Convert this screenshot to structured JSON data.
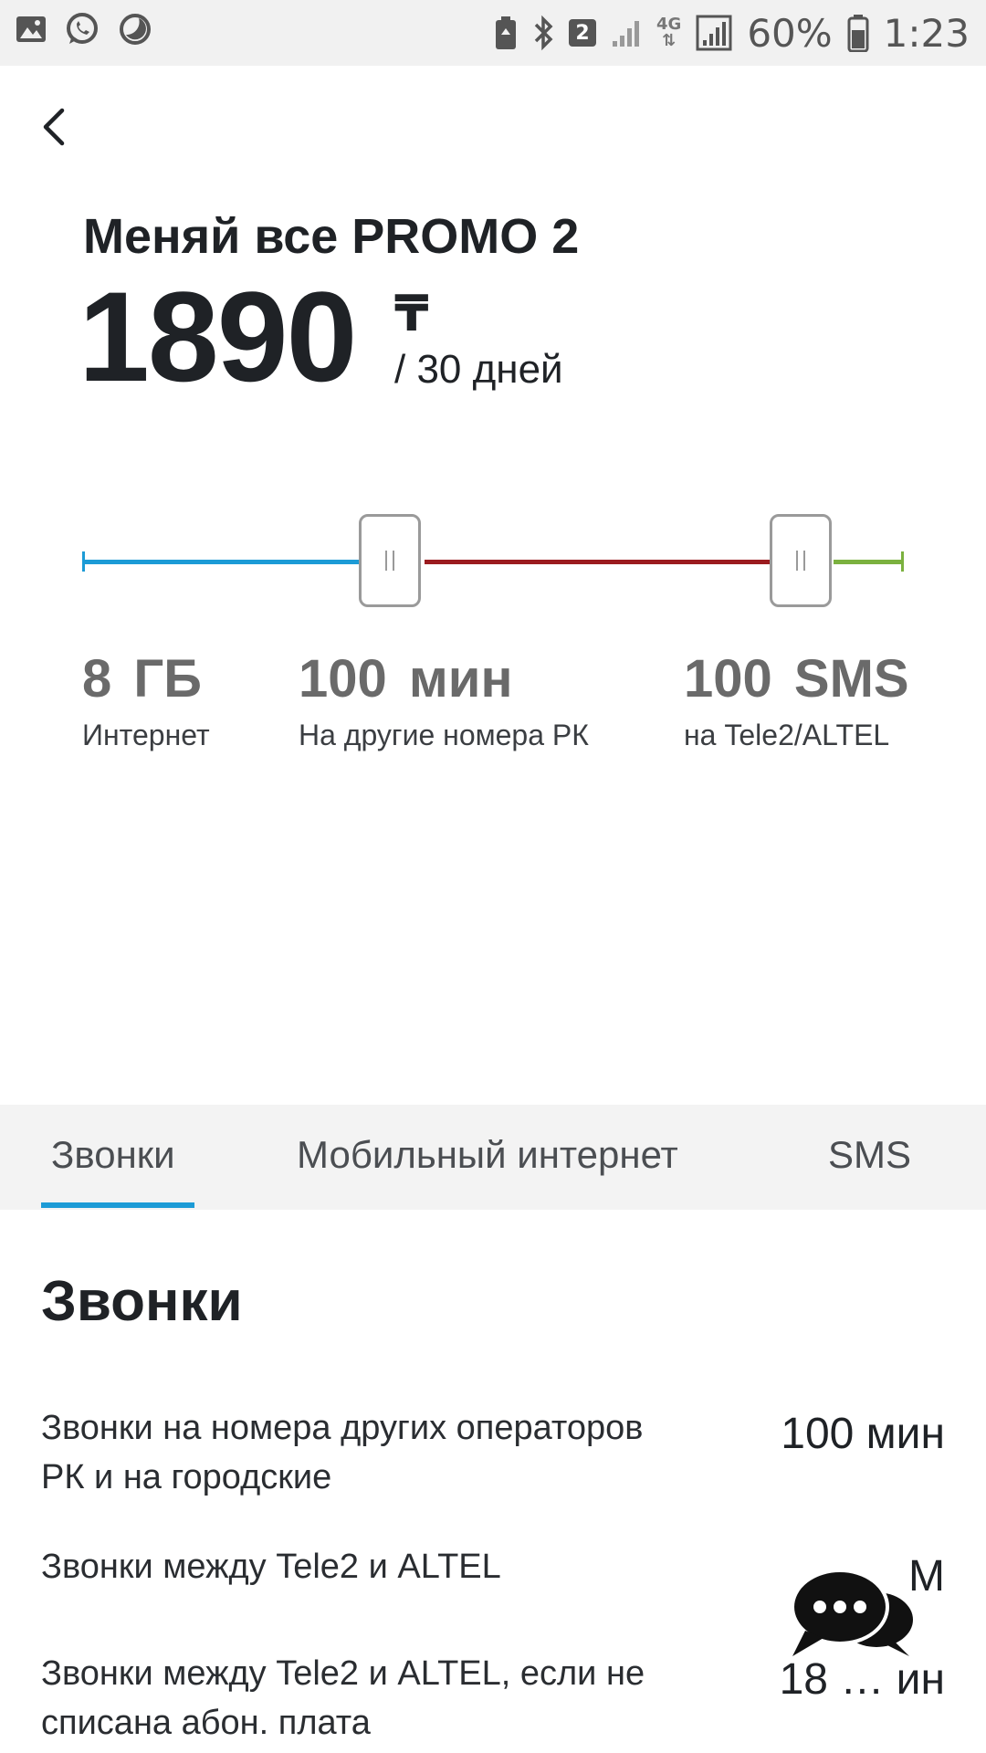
{
  "status_bar": {
    "battery": "60%",
    "time": "1:23",
    "sim_badge": "2",
    "network": "4G",
    "icons": [
      "gallery-icon",
      "whatsapp-icon",
      "moon-icon",
      "battery-saver-icon",
      "bluetooth-icon",
      "sim2-icon",
      "signal-icon",
      "lte-icon",
      "signal-icon",
      "battery-icon"
    ]
  },
  "header": {
    "back_icon": "chevron-left-icon",
    "title": "Меняй все PROMO 2",
    "price": "1890",
    "currency": "₸",
    "period": "/ 30 дней"
  },
  "slider": {
    "colors": {
      "internet": "#1c9bd6",
      "calls": "#9b1b1f",
      "sms": "#7bb13f"
    }
  },
  "stats": [
    {
      "value": "8 ГБ",
      "label": "Интернет"
    },
    {
      "value": "100 мин",
      "label": "На другие номера РК"
    },
    {
      "value": "100 SMS",
      "label": "на Tele2/ALTEL"
    }
  ],
  "tabs": [
    {
      "label": "Звонки",
      "active": true
    },
    {
      "label": "Мобильный интернет",
      "active": false
    },
    {
      "label": "SMS",
      "active": false
    }
  ],
  "accent_color": "#1c9bd6",
  "section": {
    "title": "Звонки",
    "rows": [
      {
        "label": "Звонки на номера других операторов РК и на городские",
        "value": "100 мин"
      },
      {
        "label": "Звонки между Tele2 и ALTEL",
        "value": "М"
      },
      {
        "label": "Звонки между Tele2 и ALTEL, если не списана абон. плата",
        "value": "18 … ин"
      }
    ]
  },
  "chat_fab": {
    "icon": "chat-bubbles-icon"
  }
}
